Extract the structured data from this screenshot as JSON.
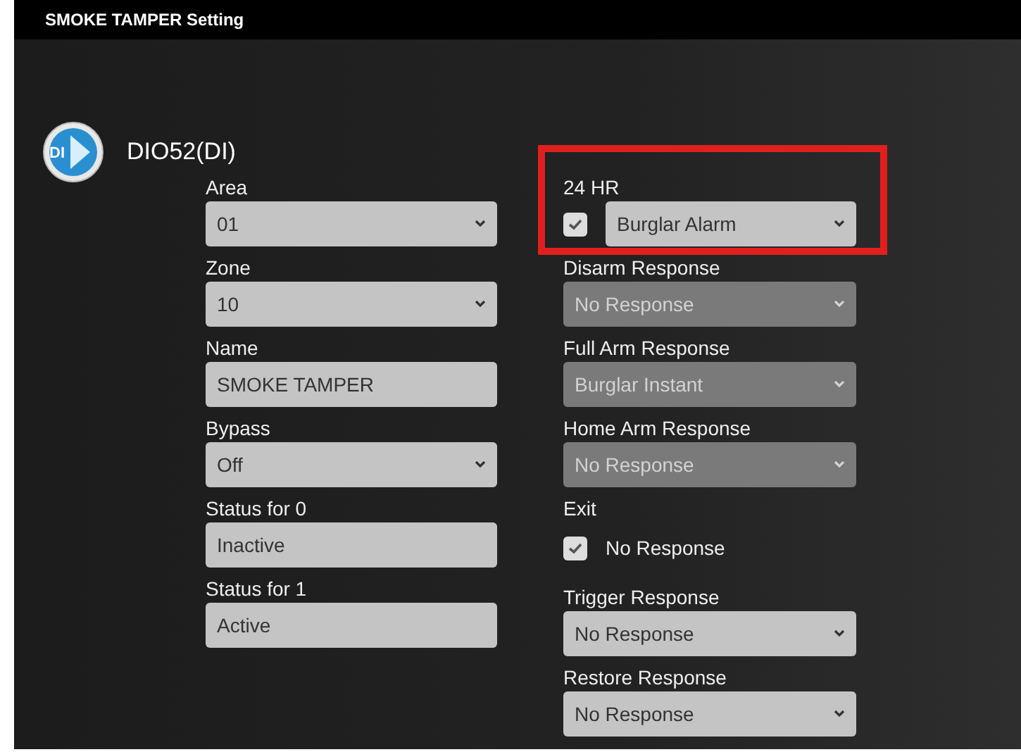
{
  "window": {
    "title": "SMOKE TAMPER Setting"
  },
  "device": {
    "icon_label": "DI",
    "name": "DIO52(DI)"
  },
  "left_fields": [
    {
      "label": "Area",
      "kind": "select",
      "value": "01",
      "disabled": false
    },
    {
      "label": "Zone",
      "kind": "select",
      "value": "10",
      "disabled": false
    },
    {
      "label": "Name",
      "kind": "text",
      "value": "SMOKE TAMPER",
      "disabled": false
    },
    {
      "label": "Bypass",
      "kind": "select",
      "value": "Off",
      "disabled": false
    },
    {
      "label": "Status for 0",
      "kind": "text",
      "value": "Inactive",
      "disabled": false
    },
    {
      "label": "Status for 1",
      "kind": "text",
      "value": "Active",
      "disabled": false
    }
  ],
  "right_fields": [
    {
      "label": "24 HR",
      "kind": "checkbox_select",
      "checked": true,
      "value": "Burglar Alarm",
      "disabled": false,
      "highlighted": true
    },
    {
      "label": "Disarm Response",
      "kind": "select",
      "value": "No Response",
      "disabled": true,
      "highlighted": false
    },
    {
      "label": "Full Arm Response",
      "kind": "select",
      "value": "Burglar Instant",
      "disabled": true,
      "highlighted": false
    },
    {
      "label": "Home Arm Response",
      "kind": "select",
      "value": "No Response",
      "disabled": true,
      "highlighted": false
    },
    {
      "label": "Exit",
      "kind": "checkbox",
      "checked": true,
      "value": "No Response",
      "highlighted": false
    },
    {
      "label": "Trigger Response",
      "kind": "select",
      "value": "No Response",
      "disabled": false,
      "highlighted": false
    },
    {
      "label": "Restore Response",
      "kind": "select",
      "value": "No Response",
      "disabled": false,
      "highlighted": false
    }
  ]
}
